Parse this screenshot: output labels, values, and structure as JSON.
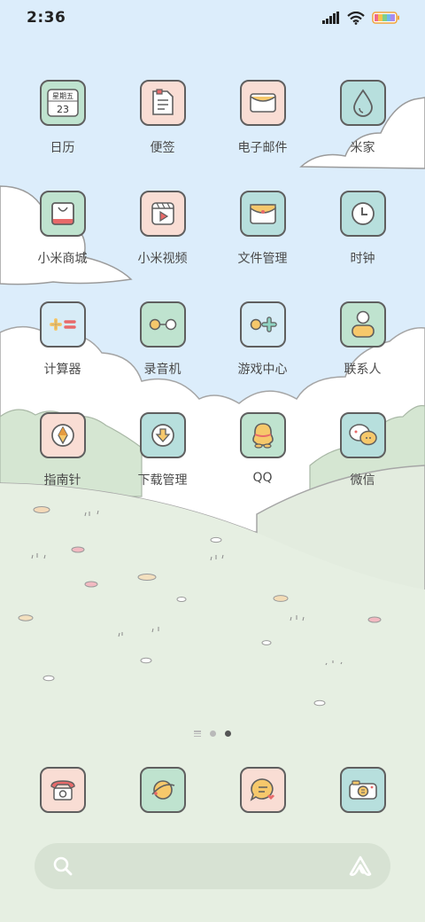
{
  "status_bar": {
    "time": "2:36"
  },
  "apps": [
    [
      {
        "label": "日历",
        "icon": "calendar-icon",
        "tile_color": "#bfe3cf",
        "calendar_text": "星期五",
        "calendar_date": "23"
      },
      {
        "label": "便签",
        "icon": "notes-icon",
        "tile_color": "#f9ddd4"
      },
      {
        "label": "电子邮件",
        "icon": "email-icon",
        "tile_color": "#f9ddd4"
      },
      {
        "label": "米家",
        "icon": "water-drop-icon",
        "tile_color": "#b7dfdd"
      }
    ],
    [
      {
        "label": "小米商城",
        "icon": "shopping-bag-icon",
        "tile_color": "#bfe3cf"
      },
      {
        "label": "小米视频",
        "icon": "video-icon",
        "tile_color": "#f9ddd4"
      },
      {
        "label": "文件管理",
        "icon": "folder-icon",
        "tile_color": "#b7dfdd"
      },
      {
        "label": "时钟",
        "icon": "clock-icon",
        "tile_color": "#b7dfdd"
      }
    ],
    [
      {
        "label": "计算器",
        "icon": "calculator-icon",
        "tile_color": "#d7ecf7"
      },
      {
        "label": "录音机",
        "icon": "recorder-icon",
        "tile_color": "#bfe3cf"
      },
      {
        "label": "游戏中心",
        "icon": "game-icon",
        "tile_color": "#d7ecf7"
      },
      {
        "label": "联系人",
        "icon": "contact-icon",
        "tile_color": "#bfe3cf"
      }
    ],
    [
      {
        "label": "指南针",
        "icon": "compass-icon",
        "tile_color": "#f9ddd4"
      },
      {
        "label": "下载管理",
        "icon": "download-icon",
        "tile_color": "#b7dfdd"
      },
      {
        "label": "QQ",
        "icon": "qq-icon",
        "tile_color": "#bfe3cf"
      },
      {
        "label": "微信",
        "icon": "wechat-icon",
        "tile_color": "#b7dfdd"
      }
    ]
  ],
  "page_indicator": {
    "count": 2,
    "active": 2
  },
  "dock": [
    {
      "icon": "phone-icon",
      "tile_color": "#f9ddd4"
    },
    {
      "icon": "browser-icon",
      "tile_color": "#bfe3cf"
    },
    {
      "icon": "message-icon",
      "tile_color": "#f9ddd4"
    },
    {
      "icon": "camera-icon",
      "tile_color": "#b7dfdd"
    }
  ],
  "search_bar": {
    "left_icon": "search-icon",
    "right_icon": "assistant-icon"
  },
  "colors": {
    "sky": "#dcedfb",
    "meadow": "#e6efe2",
    "outline": "#5f5f5f",
    "yellow": "#f6c86b",
    "red": "#e86a6a"
  }
}
